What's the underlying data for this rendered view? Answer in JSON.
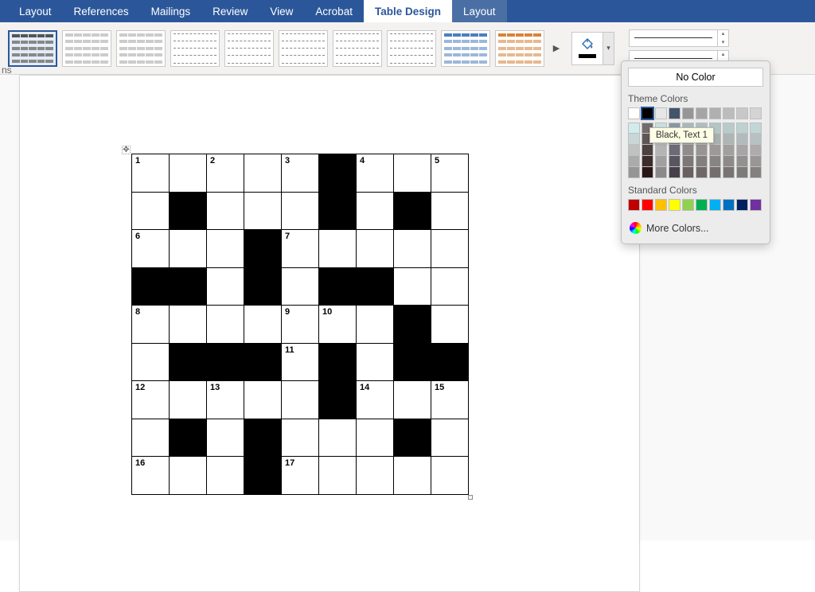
{
  "tabs": [
    "Layout",
    "References",
    "Mailings",
    "Review",
    "View",
    "Acrobat"
  ],
  "contextual_tabs": [
    "Table Design",
    "Layout"
  ],
  "active_tab": "Table Design",
  "ribbon_edge_label": "ns",
  "color_panel": {
    "no_color": "No Color",
    "theme_label": "Theme Colors",
    "standard_label": "Standard Colors",
    "more_colors": "More Colors...",
    "tooltip": "Black, Text 1",
    "theme_row": [
      "#ffffff",
      "#000000",
      "#e7e6e6",
      "#44546a",
      "#969696",
      "#a5a5a5",
      "#b0b0b0",
      "#bcbcbc",
      "#c8c8c8",
      "#d4d4d4"
    ],
    "standard_row": [
      "#c00000",
      "#ff0000",
      "#ffc000",
      "#ffff00",
      "#92d050",
      "#00b050",
      "#00b0f0",
      "#0070c0",
      "#002060",
      "#7030a0"
    ]
  },
  "crossword": {
    "rows": 9,
    "cols": 9,
    "black_cells": [
      [
        0,
        5
      ],
      [
        1,
        1
      ],
      [
        1,
        5
      ],
      [
        1,
        7
      ],
      [
        2,
        3
      ],
      [
        3,
        0
      ],
      [
        3,
        1
      ],
      [
        3,
        3
      ],
      [
        3,
        5
      ],
      [
        3,
        6
      ],
      [
        4,
        7
      ],
      [
        5,
        1
      ],
      [
        5,
        2
      ],
      [
        5,
        3
      ],
      [
        5,
        5
      ],
      [
        5,
        7
      ],
      [
        5,
        8
      ],
      [
        6,
        5
      ],
      [
        7,
        1
      ],
      [
        7,
        3
      ],
      [
        7,
        7
      ],
      [
        8,
        3
      ]
    ],
    "numbers": {
      "0,0": "1",
      "0,2": "2",
      "0,4": "3",
      "0,6": "4",
      "0,8": "5",
      "2,0": "6",
      "2,4": "7",
      "4,0": "8",
      "4,4": "9",
      "4,5": "10",
      "5,4": "11",
      "6,0": "12",
      "6,2": "13",
      "6,6": "14",
      "6,8": "15",
      "8,0": "16",
      "8,4": "17"
    }
  }
}
